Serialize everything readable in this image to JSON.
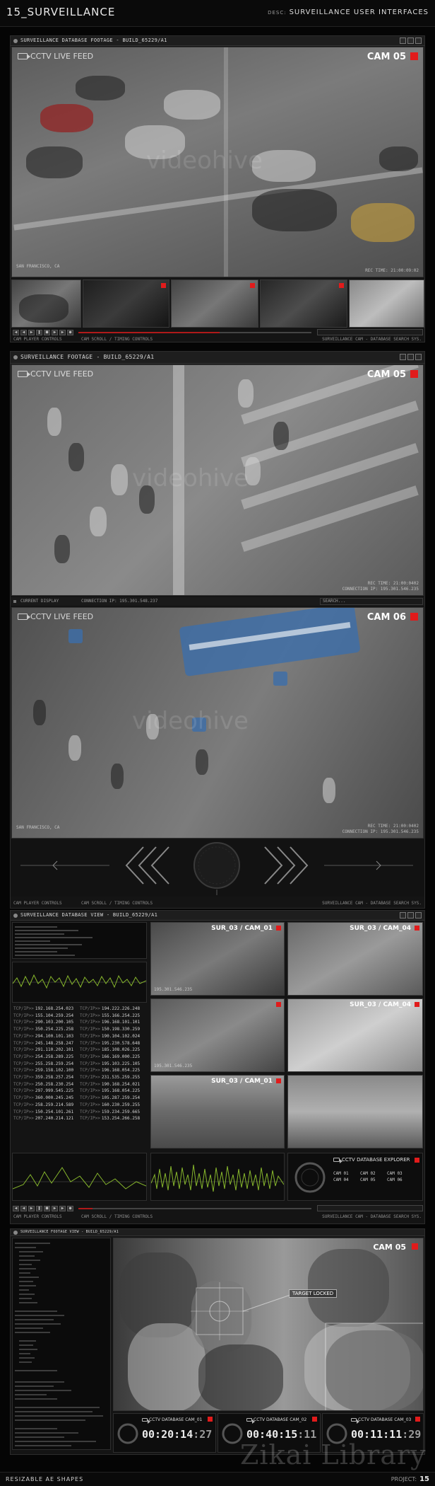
{
  "page": {
    "title": "15_SURVEILLANCE",
    "desc_label": "DESC:",
    "desc": "SURVEILLANCE USER INTERFACES"
  },
  "panel1": {
    "title": "SURVEILLANCE DATABASE FOOTAGE - BUILD_65229/A1",
    "feed_label": "CCTV LIVE FEED",
    "cam": "CAM 05",
    "location": "SAN FRANCISCO, CA",
    "rec_time": "REC TIME: 21:00:09:02",
    "watermark": "videohive",
    "strip_left": "CAM PLAYER CONTROLS",
    "strip_mid": "CAM SCROLL / TIMING CONTROLS",
    "strip_right": "SURVEILLANCE CAM - DATABASE SEARCH SYS."
  },
  "panel2": {
    "title": "SURVEILLANCE FOOTAGE - BUILD_65229/A1",
    "feed_label": "CCTV LIVE FEED",
    "cam": "CAM 05",
    "rec_time": "REC TIME: 21:00:0402",
    "connection": "CONNECTION IP: 195.301.546.235",
    "watermark": "videohive",
    "info_left": "CURRENT DISPLAY",
    "info_mid": "CONNECTION IP: 195.301.548.237",
    "search": "SEARCH...",
    "feed2_label": "CCTV LIVE FEED",
    "cam2": "CAM 06",
    "location2": "SAN FRANCISCO, CA",
    "rec_time2": "REC TIME: 21:00:0402",
    "connection2": "CONNECTION IP: 195.301.546.235",
    "strip_left": "CAM PLAYER CONTROLS",
    "strip_mid": "CAM SCROLL / TIMING CONTROLS",
    "strip_right": "SURVEILLANCE CAM - DATABASE SEARCH SYS."
  },
  "panel3": {
    "title": "SURVEILLANCE DATABASE VIEW - BUILD_65229/A1",
    "cams": [
      {
        "label": "SUR_03 / CAM_01",
        "ip": "195.301.546.235"
      },
      {
        "label": "SUR_03 / CAM_04",
        "ip": ""
      },
      {
        "label": "",
        "ip": "195.301.546.235"
      },
      {
        "label": "SUR_03 / CAM_04",
        "ip": ""
      },
      {
        "label": "SUR_03 / CAM_01",
        "ip": ""
      },
      {
        "label": "",
        "ip": ""
      }
    ],
    "ip_rows_left": [
      "192.168.254.023",
      "155.104.259.254",
      "290.103.200.105",
      "350.254.225.258",
      "294.100.101.103",
      "245.148.258.247",
      "291.110.202.101",
      "254.258.289.225",
      "255.258.259.254",
      "259.158.102.100",
      "359.258.257.254",
      "250.258.230.254",
      "297.999.545.225",
      "360.000.245.245",
      "258.259.214.589",
      "150.254.101.261",
      "207.240.214.121"
    ],
    "ip_rows_right": [
      "194.222.226.248",
      "155.166.254.225",
      "196.168.101.101",
      "150.198.330.259",
      "190.104.102.024",
      "195.230.578.648",
      "185.108.026.225",
      "166.169.000.225",
      "195.103.225.105",
      "196.168.054.225",
      "231.535.259.255",
      "190.168.254.021",
      "195.168.054.225",
      "105.287.259.254",
      "160.230.259.255",
      "159.234.259.665",
      "153.254.266.258"
    ],
    "ip_prefix": "TCP/IP>>",
    "explorer_title": "CCTV DATABASE EXPLORER",
    "explorer_cams": [
      "CAM 01",
      "CAM 02",
      "CAM 03",
      "CAM 04",
      "CAM 05",
      "CAM 06"
    ],
    "strip_left": "CAM PLAYER CONTROLS",
    "strip_mid": "CAM SCROLL / TIMING CONTROLS",
    "strip_right": "SURVEILLANCE CAM - DATABASE SEARCH SYS."
  },
  "panel4": {
    "title": "SURVEILLANCE FOOTAGE VIEW - BUILD_65229/A1",
    "cam": "CAM 05",
    "target": "TARGET LOCKED",
    "clips": [
      {
        "label": "CCTV DATABASE CAM_01",
        "time": "00:20:14",
        "ms": ":27"
      },
      {
        "label": "CCTV DATABASE CAM_02",
        "time": "00:40:15",
        "ms": ":11"
      },
      {
        "label": "CCTV DATABASE CAM_03",
        "time": "00:11:11",
        "ms": ":29"
      }
    ]
  },
  "footer": {
    "left": "RESIZABLE AE SHAPES",
    "project_label": "PROJECT:",
    "project": "15"
  },
  "signature": "Zikai Library",
  "colors": {
    "rec": "#e11b1b",
    "graph": "#86b62c",
    "bg": "#050505"
  }
}
